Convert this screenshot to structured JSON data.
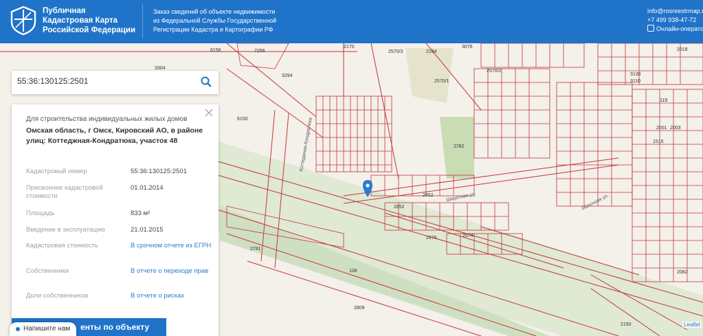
{
  "header": {
    "brand": [
      "Публичная",
      "Кадастровая Карта",
      "Российской Федерации"
    ],
    "description": [
      "Заказ сведений об объекте недвижимости",
      "из Федеральной Службы Государственной",
      "Регистрации Кадастра и Картографии РФ"
    ],
    "email": "info@rosreestrmap.ru",
    "phone": "+7 499 938-47-72",
    "chat": "Онлайн-оператор"
  },
  "search": {
    "value": "55:36:130125:2501"
  },
  "panel": {
    "type": "Для строительства индивидуальных жилых домов",
    "address": "Омская область, г Омск, Кировский АО, в районе улиц: Коттеджная-Кондратюка, участок 48",
    "rows": [
      {
        "label": "Кадастровый номер",
        "value": "55:36:130125:2501"
      },
      {
        "label": "Присвоение кадастровой стоимости",
        "value": "01.01.2014"
      },
      {
        "label": "Площадь",
        "value": "833 м²"
      },
      {
        "label": "Введение в эксплуатацию",
        "value": "21.01.2015"
      },
      {
        "label": "Кадастровая стоимость",
        "value": "В срочном отчете из ЕГРН"
      },
      {
        "label": "Собственники",
        "value": "В отчете о переходе прав"
      },
      {
        "label": "Доли собственников",
        "value": "В отчете о рисках"
      }
    ],
    "report_button": "енты по объекту"
  },
  "write_us": "Напишите нам",
  "leaflet": "Leaflet",
  "map_labels": {
    "parcels": [
      "6156",
      "3304",
      "7256",
      "3294",
      "2170",
      "2164",
      "3076",
      "2570/3",
      "2570/2",
      "2570/1",
      "6150",
      "2782",
      "2652",
      "2676",
      "2674",
      "2781",
      "108",
      "2809",
      "2150",
      "3130",
      "3110",
      "2018",
      "119",
      "2001",
      "2003",
      "1516",
      "2082",
      "2652"
    ],
    "streets": [
      "Коттеджная-Кондратюка",
      "Широтная ул.",
      "Яблочная ул."
    ]
  },
  "colors": {
    "header": "#1f73c9",
    "parcel": "#c4343c",
    "marker": "#2b7ad0"
  }
}
